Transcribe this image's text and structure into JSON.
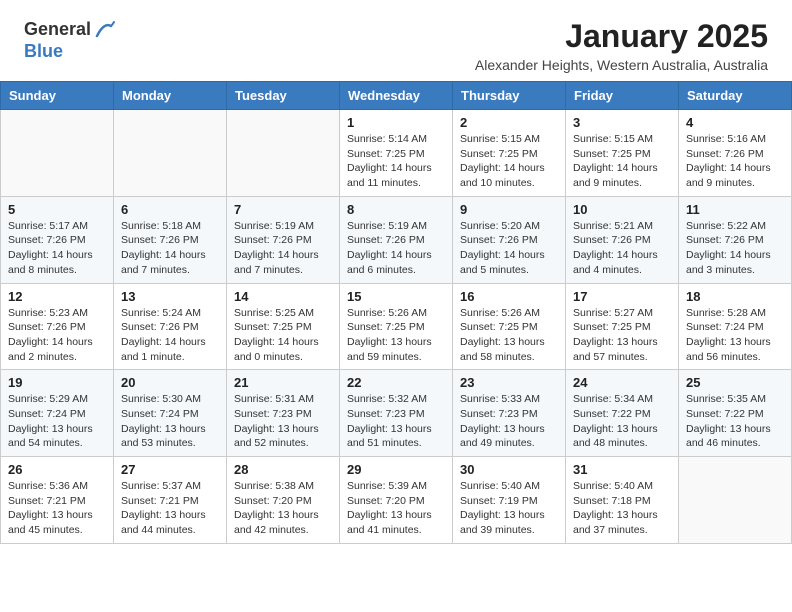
{
  "header": {
    "logo_general": "General",
    "logo_blue": "Blue",
    "month_year": "January 2025",
    "location": "Alexander Heights, Western Australia, Australia"
  },
  "calendar": {
    "days_of_week": [
      "Sunday",
      "Monday",
      "Tuesday",
      "Wednesday",
      "Thursday",
      "Friday",
      "Saturday"
    ],
    "weeks": [
      [
        {
          "day": "",
          "sunrise": "",
          "sunset": "",
          "daylight": ""
        },
        {
          "day": "",
          "sunrise": "",
          "sunset": "",
          "daylight": ""
        },
        {
          "day": "",
          "sunrise": "",
          "sunset": "",
          "daylight": ""
        },
        {
          "day": "1",
          "sunrise": "Sunrise: 5:14 AM",
          "sunset": "Sunset: 7:25 PM",
          "daylight": "Daylight: 14 hours and 11 minutes."
        },
        {
          "day": "2",
          "sunrise": "Sunrise: 5:15 AM",
          "sunset": "Sunset: 7:25 PM",
          "daylight": "Daylight: 14 hours and 10 minutes."
        },
        {
          "day": "3",
          "sunrise": "Sunrise: 5:15 AM",
          "sunset": "Sunset: 7:25 PM",
          "daylight": "Daylight: 14 hours and 9 minutes."
        },
        {
          "day": "4",
          "sunrise": "Sunrise: 5:16 AM",
          "sunset": "Sunset: 7:26 PM",
          "daylight": "Daylight: 14 hours and 9 minutes."
        }
      ],
      [
        {
          "day": "5",
          "sunrise": "Sunrise: 5:17 AM",
          "sunset": "Sunset: 7:26 PM",
          "daylight": "Daylight: 14 hours and 8 minutes."
        },
        {
          "day": "6",
          "sunrise": "Sunrise: 5:18 AM",
          "sunset": "Sunset: 7:26 PM",
          "daylight": "Daylight: 14 hours and 7 minutes."
        },
        {
          "day": "7",
          "sunrise": "Sunrise: 5:19 AM",
          "sunset": "Sunset: 7:26 PM",
          "daylight": "Daylight: 14 hours and 7 minutes."
        },
        {
          "day": "8",
          "sunrise": "Sunrise: 5:19 AM",
          "sunset": "Sunset: 7:26 PM",
          "daylight": "Daylight: 14 hours and 6 minutes."
        },
        {
          "day": "9",
          "sunrise": "Sunrise: 5:20 AM",
          "sunset": "Sunset: 7:26 PM",
          "daylight": "Daylight: 14 hours and 5 minutes."
        },
        {
          "day": "10",
          "sunrise": "Sunrise: 5:21 AM",
          "sunset": "Sunset: 7:26 PM",
          "daylight": "Daylight: 14 hours and 4 minutes."
        },
        {
          "day": "11",
          "sunrise": "Sunrise: 5:22 AM",
          "sunset": "Sunset: 7:26 PM",
          "daylight": "Daylight: 14 hours and 3 minutes."
        }
      ],
      [
        {
          "day": "12",
          "sunrise": "Sunrise: 5:23 AM",
          "sunset": "Sunset: 7:26 PM",
          "daylight": "Daylight: 14 hours and 2 minutes."
        },
        {
          "day": "13",
          "sunrise": "Sunrise: 5:24 AM",
          "sunset": "Sunset: 7:26 PM",
          "daylight": "Daylight: 14 hours and 1 minute."
        },
        {
          "day": "14",
          "sunrise": "Sunrise: 5:25 AM",
          "sunset": "Sunset: 7:25 PM",
          "daylight": "Daylight: 14 hours and 0 minutes."
        },
        {
          "day": "15",
          "sunrise": "Sunrise: 5:26 AM",
          "sunset": "Sunset: 7:25 PM",
          "daylight": "Daylight: 13 hours and 59 minutes."
        },
        {
          "day": "16",
          "sunrise": "Sunrise: 5:26 AM",
          "sunset": "Sunset: 7:25 PM",
          "daylight": "Daylight: 13 hours and 58 minutes."
        },
        {
          "day": "17",
          "sunrise": "Sunrise: 5:27 AM",
          "sunset": "Sunset: 7:25 PM",
          "daylight": "Daylight: 13 hours and 57 minutes."
        },
        {
          "day": "18",
          "sunrise": "Sunrise: 5:28 AM",
          "sunset": "Sunset: 7:24 PM",
          "daylight": "Daylight: 13 hours and 56 minutes."
        }
      ],
      [
        {
          "day": "19",
          "sunrise": "Sunrise: 5:29 AM",
          "sunset": "Sunset: 7:24 PM",
          "daylight": "Daylight: 13 hours and 54 minutes."
        },
        {
          "day": "20",
          "sunrise": "Sunrise: 5:30 AM",
          "sunset": "Sunset: 7:24 PM",
          "daylight": "Daylight: 13 hours and 53 minutes."
        },
        {
          "day": "21",
          "sunrise": "Sunrise: 5:31 AM",
          "sunset": "Sunset: 7:23 PM",
          "daylight": "Daylight: 13 hours and 52 minutes."
        },
        {
          "day": "22",
          "sunrise": "Sunrise: 5:32 AM",
          "sunset": "Sunset: 7:23 PM",
          "daylight": "Daylight: 13 hours and 51 minutes."
        },
        {
          "day": "23",
          "sunrise": "Sunrise: 5:33 AM",
          "sunset": "Sunset: 7:23 PM",
          "daylight": "Daylight: 13 hours and 49 minutes."
        },
        {
          "day": "24",
          "sunrise": "Sunrise: 5:34 AM",
          "sunset": "Sunset: 7:22 PM",
          "daylight": "Daylight: 13 hours and 48 minutes."
        },
        {
          "day": "25",
          "sunrise": "Sunrise: 5:35 AM",
          "sunset": "Sunset: 7:22 PM",
          "daylight": "Daylight: 13 hours and 46 minutes."
        }
      ],
      [
        {
          "day": "26",
          "sunrise": "Sunrise: 5:36 AM",
          "sunset": "Sunset: 7:21 PM",
          "daylight": "Daylight: 13 hours and 45 minutes."
        },
        {
          "day": "27",
          "sunrise": "Sunrise: 5:37 AM",
          "sunset": "Sunset: 7:21 PM",
          "daylight": "Daylight: 13 hours and 44 minutes."
        },
        {
          "day": "28",
          "sunrise": "Sunrise: 5:38 AM",
          "sunset": "Sunset: 7:20 PM",
          "daylight": "Daylight: 13 hours and 42 minutes."
        },
        {
          "day": "29",
          "sunrise": "Sunrise: 5:39 AM",
          "sunset": "Sunset: 7:20 PM",
          "daylight": "Daylight: 13 hours and 41 minutes."
        },
        {
          "day": "30",
          "sunrise": "Sunrise: 5:40 AM",
          "sunset": "Sunset: 7:19 PM",
          "daylight": "Daylight: 13 hours and 39 minutes."
        },
        {
          "day": "31",
          "sunrise": "Sunrise: 5:40 AM",
          "sunset": "Sunset: 7:18 PM",
          "daylight": "Daylight: 13 hours and 37 minutes."
        },
        {
          "day": "",
          "sunrise": "",
          "sunset": "",
          "daylight": ""
        }
      ]
    ]
  }
}
